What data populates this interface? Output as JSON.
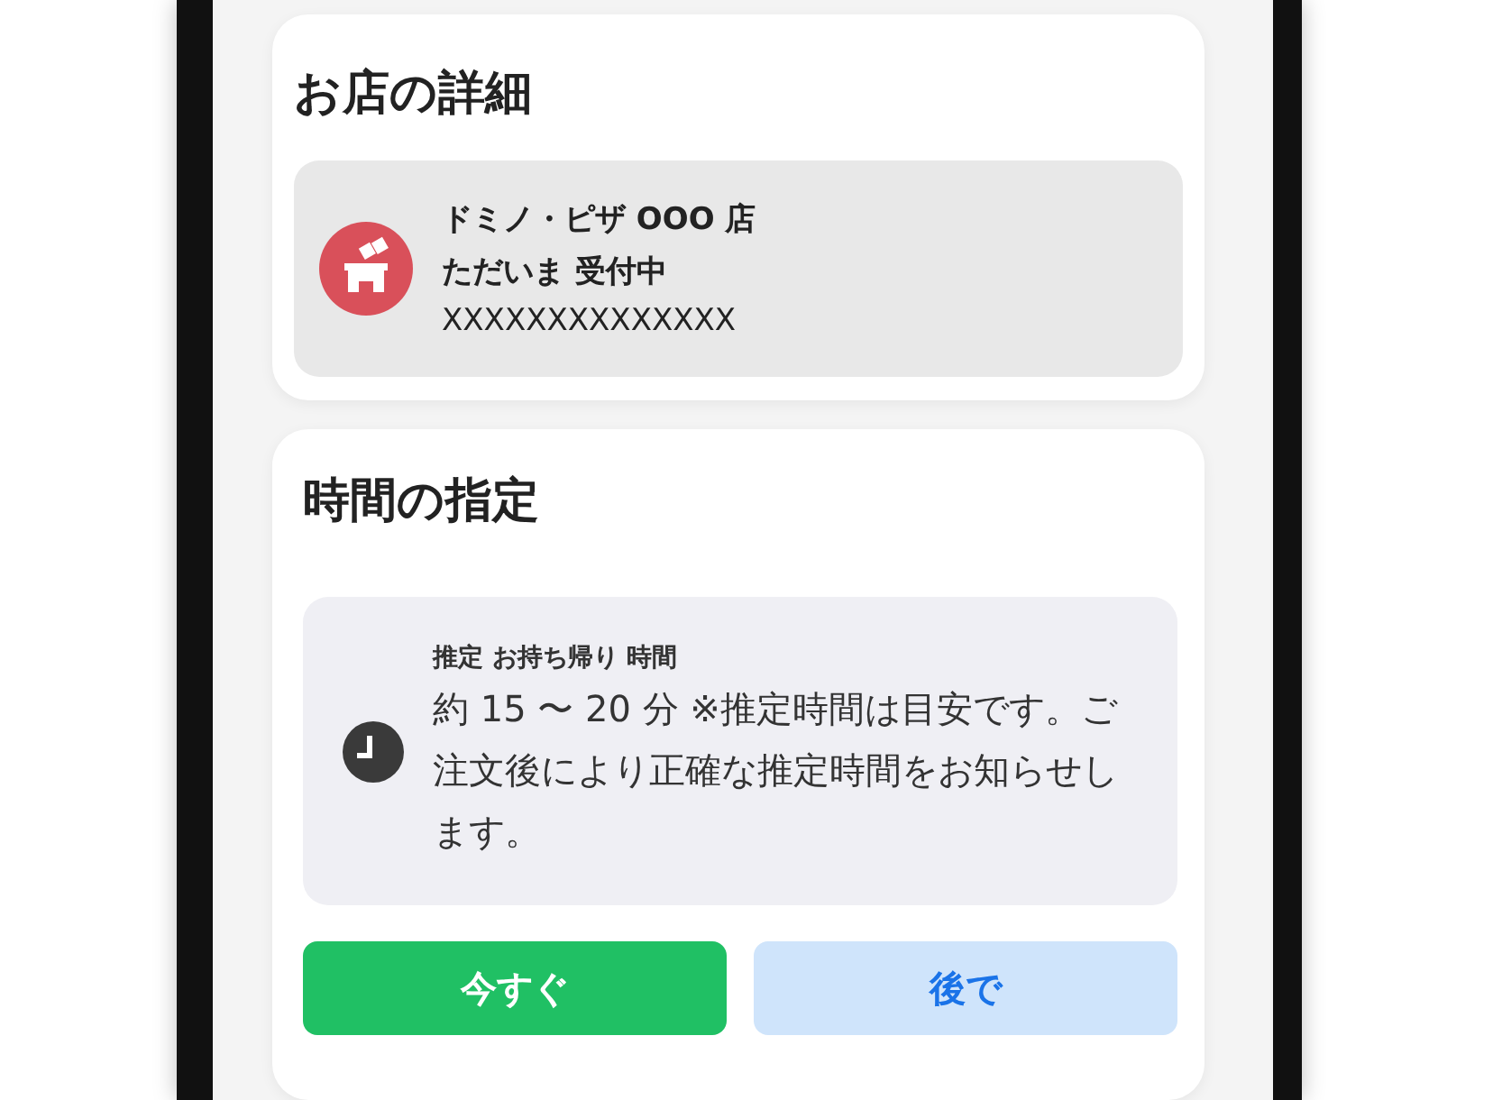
{
  "store_details": {
    "title": "お店の詳細",
    "store": {
      "name": "ドミノ・ピザ OOO 店",
      "status": "ただいま 受付中",
      "address": "XXXXXXXXXXXXXX"
    }
  },
  "time_selection": {
    "title": "時間の指定",
    "estimate": {
      "label": "推定 お持ち帰り 時間",
      "text": "約 15 〜 20 分 ※推定時間は目安です。ご注文後により正確な推定時間をお知らせします。"
    },
    "buttons": [
      {
        "label": "今すぐ",
        "selected": true
      },
      {
        "label": "後で",
        "selected": false
      }
    ]
  }
}
